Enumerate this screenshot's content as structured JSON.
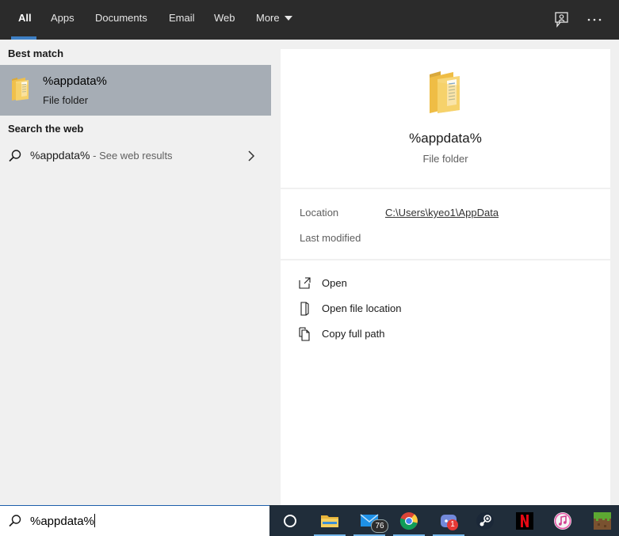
{
  "tabs": [
    {
      "label": "All",
      "active": true
    },
    {
      "label": "Apps"
    },
    {
      "label": "Documents"
    },
    {
      "label": "Email"
    },
    {
      "label": "Web"
    },
    {
      "label": "More"
    }
  ],
  "topbar_icons": [
    "feedback-icon",
    "more-options-icon"
  ],
  "results": {
    "best_match_header": "Best match",
    "best_match": {
      "title": "%appdata%",
      "subtitle": "File folder",
      "icon": "folder-icon"
    },
    "web_header": "Search the web",
    "web_result": {
      "query": "%appdata%",
      "suffix": " - See web results",
      "icon": "search-icon",
      "chevron": "chevron-right-icon"
    }
  },
  "preview": {
    "title": "%appdata%",
    "subtitle": "File folder",
    "location_label": "Location",
    "location_value": "C:\\Users\\kyeo1\\AppData",
    "last_modified_label": "Last modified",
    "actions": [
      {
        "label": "Open",
        "icon": "open-icon"
      },
      {
        "label": "Open file location",
        "icon": "file-location-icon"
      },
      {
        "label": "Copy full path",
        "icon": "copy-icon"
      }
    ]
  },
  "search": {
    "value": "%appdata%",
    "icon": "search-icon"
  },
  "taskbar": {
    "items": [
      {
        "name": "cortana-icon"
      },
      {
        "name": "file-explorer-icon",
        "active": true
      },
      {
        "name": "mail-icon",
        "badge": "76",
        "active": true
      },
      {
        "name": "chrome-icon",
        "active": true
      },
      {
        "name": "discord-icon",
        "badge": "1",
        "active": true
      },
      {
        "name": "steam-icon"
      },
      {
        "name": "netflix-icon"
      },
      {
        "name": "itunes-icon"
      },
      {
        "name": "minecraft-icon"
      }
    ]
  },
  "colors": {
    "accent": "#3d7fc4",
    "selected_row": "#a6adb5",
    "topbar": "#2b2b2b",
    "taskbar": "#202d3a"
  }
}
